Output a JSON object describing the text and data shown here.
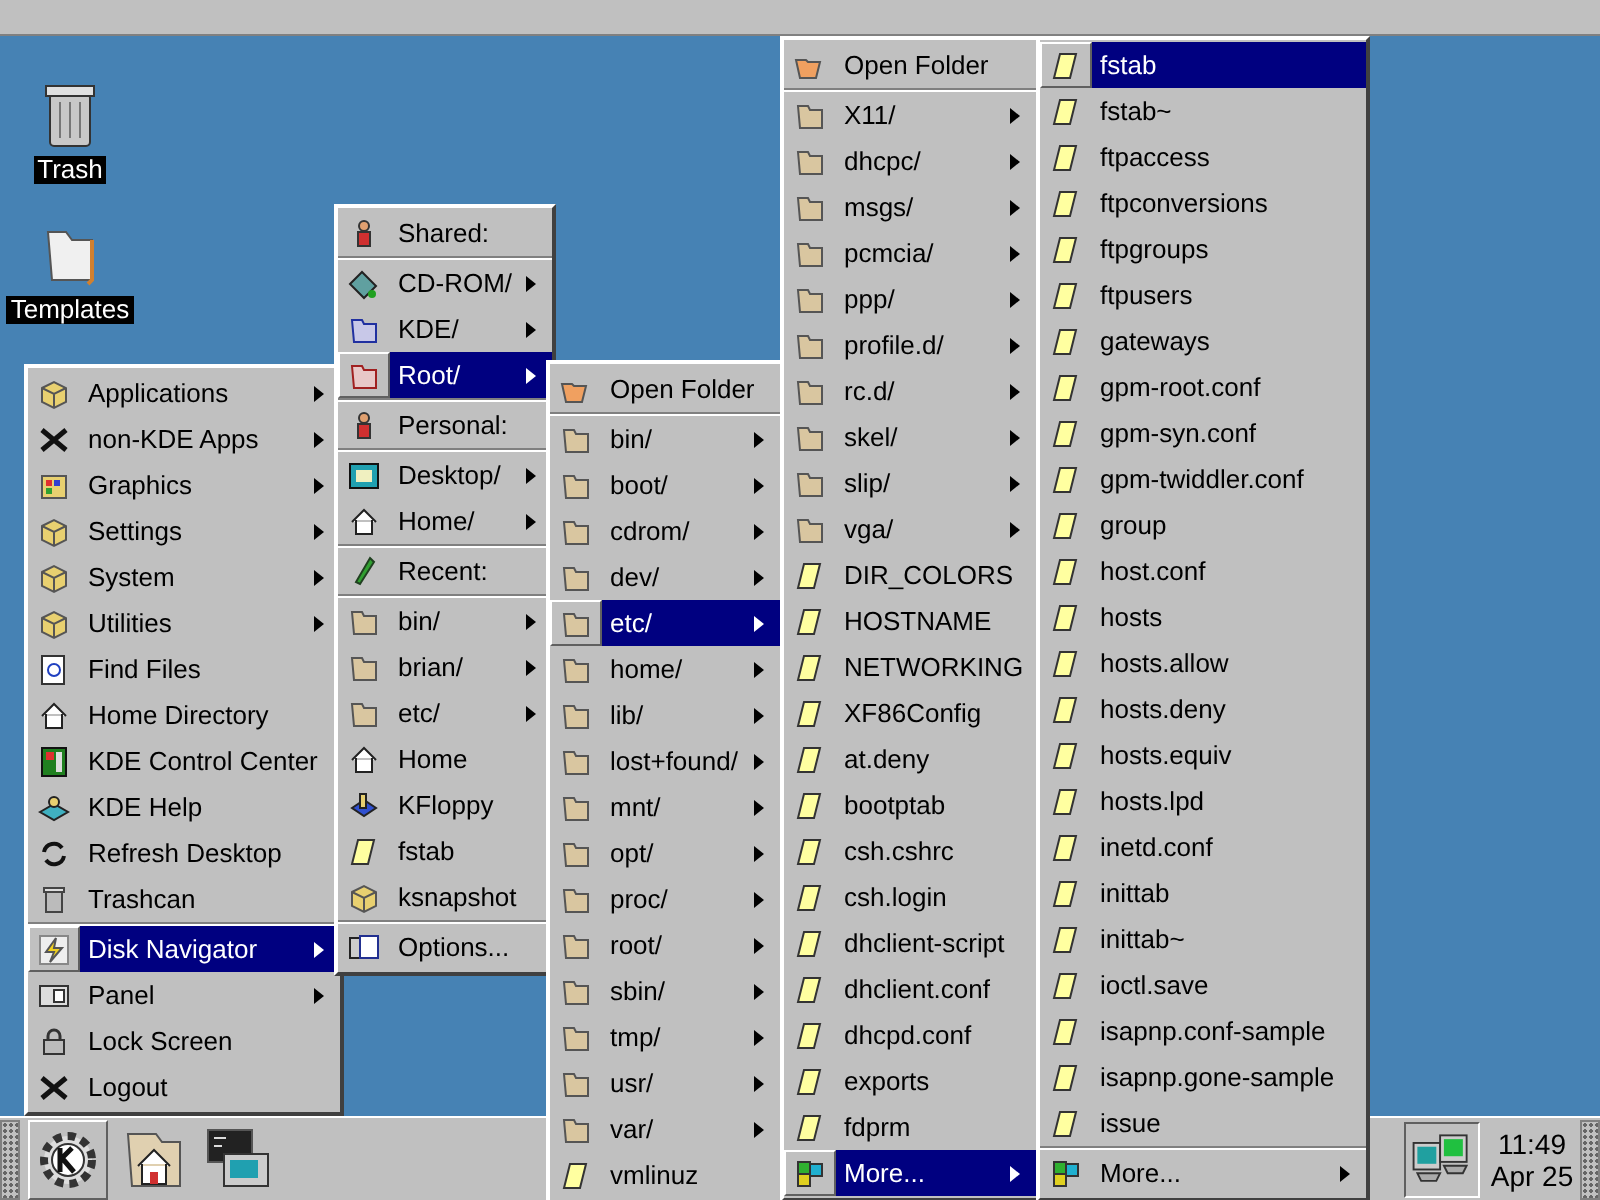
{
  "desktop_icons": [
    {
      "label": "Trash"
    },
    {
      "label": "Templates"
    }
  ],
  "menus": [
    {
      "items": [
        {
          "label": "Applications",
          "kind": "submenu",
          "selected": false
        },
        {
          "label": "non-KDE Apps",
          "kind": "submenu",
          "selected": false
        },
        {
          "label": "Graphics",
          "kind": "submenu",
          "selected": false
        },
        {
          "label": "Settings",
          "kind": "submenu",
          "selected": false
        },
        {
          "label": "System",
          "kind": "submenu",
          "selected": false
        },
        {
          "label": "Utilities",
          "kind": "submenu",
          "selected": false
        },
        {
          "label": "Find Files",
          "kind": "action",
          "selected": false
        },
        {
          "label": "Home Directory",
          "kind": "action",
          "selected": false
        },
        {
          "label": "KDE Control Center",
          "kind": "action",
          "selected": false
        },
        {
          "label": "KDE Help",
          "kind": "action",
          "selected": false
        },
        {
          "label": "Refresh Desktop",
          "kind": "action",
          "selected": false
        },
        {
          "label": "Trashcan",
          "kind": "action",
          "selected": false
        },
        {
          "kind": "separator"
        },
        {
          "label": "Disk Navigator",
          "kind": "submenu",
          "selected": true
        },
        {
          "label": "Panel",
          "kind": "submenu",
          "selected": false
        },
        {
          "label": "Lock Screen",
          "kind": "action",
          "selected": false
        },
        {
          "label": "Logout",
          "kind": "action",
          "selected": false
        }
      ]
    },
    {
      "items": [
        {
          "label": "Shared:",
          "kind": "header"
        },
        {
          "kind": "separator"
        },
        {
          "label": "CD-ROM/",
          "kind": "submenu",
          "selected": false
        },
        {
          "label": "KDE/",
          "kind": "submenu",
          "selected": false
        },
        {
          "label": "Root/",
          "kind": "submenu",
          "selected": true
        },
        {
          "kind": "separator"
        },
        {
          "label": "Personal:",
          "kind": "header"
        },
        {
          "kind": "separator"
        },
        {
          "label": "Desktop/",
          "kind": "submenu",
          "selected": false
        },
        {
          "label": "Home/",
          "kind": "submenu",
          "selected": false
        },
        {
          "kind": "separator"
        },
        {
          "label": "Recent:",
          "kind": "header"
        },
        {
          "kind": "separator"
        },
        {
          "label": "bin/",
          "kind": "submenu",
          "selected": false
        },
        {
          "label": "brian/",
          "kind": "submenu",
          "selected": false
        },
        {
          "label": "etc/",
          "kind": "submenu",
          "selected": false
        },
        {
          "label": "Home",
          "kind": "action",
          "selected": false
        },
        {
          "label": "KFloppy",
          "kind": "action",
          "selected": false
        },
        {
          "label": "fstab",
          "kind": "file",
          "selected": false
        },
        {
          "label": "ksnapshot",
          "kind": "action",
          "selected": false
        },
        {
          "kind": "separator"
        },
        {
          "label": "Options...",
          "kind": "action",
          "selected": false
        }
      ]
    },
    {
      "items": [
        {
          "label": "Open Folder",
          "kind": "open",
          "selected": false
        },
        {
          "kind": "separator"
        },
        {
          "label": "bin/",
          "kind": "submenu",
          "selected": false
        },
        {
          "label": "boot/",
          "kind": "submenu",
          "selected": false
        },
        {
          "label": "cdrom/",
          "kind": "submenu",
          "selected": false
        },
        {
          "label": "dev/",
          "kind": "submenu",
          "selected": false
        },
        {
          "label": "etc/",
          "kind": "submenu",
          "selected": true
        },
        {
          "label": "home/",
          "kind": "submenu",
          "selected": false
        },
        {
          "label": "lib/",
          "kind": "submenu",
          "selected": false
        },
        {
          "label": "lost+found/",
          "kind": "submenu",
          "selected": false
        },
        {
          "label": "mnt/",
          "kind": "submenu",
          "selected": false
        },
        {
          "label": "opt/",
          "kind": "submenu",
          "selected": false
        },
        {
          "label": "proc/",
          "kind": "submenu",
          "selected": false
        },
        {
          "label": "root/",
          "kind": "submenu",
          "selected": false
        },
        {
          "label": "sbin/",
          "kind": "submenu",
          "selected": false
        },
        {
          "label": "tmp/",
          "kind": "submenu",
          "selected": false
        },
        {
          "label": "usr/",
          "kind": "submenu",
          "selected": false
        },
        {
          "label": "var/",
          "kind": "submenu",
          "selected": false
        },
        {
          "label": "vmlinuz",
          "kind": "file",
          "selected": false
        }
      ]
    },
    {
      "items": [
        {
          "label": "Open Folder",
          "kind": "open",
          "selected": false
        },
        {
          "kind": "separator"
        },
        {
          "label": "X11/",
          "kind": "submenu",
          "selected": false
        },
        {
          "label": "dhcpc/",
          "kind": "submenu",
          "selected": false
        },
        {
          "label": "msgs/",
          "kind": "submenu",
          "selected": false
        },
        {
          "label": "pcmcia/",
          "kind": "submenu",
          "selected": false
        },
        {
          "label": "ppp/",
          "kind": "submenu",
          "selected": false
        },
        {
          "label": "profile.d/",
          "kind": "submenu",
          "selected": false
        },
        {
          "label": "rc.d/",
          "kind": "submenu",
          "selected": false
        },
        {
          "label": "skel/",
          "kind": "submenu",
          "selected": false
        },
        {
          "label": "slip/",
          "kind": "submenu",
          "selected": false
        },
        {
          "label": "vga/",
          "kind": "submenu",
          "selected": false
        },
        {
          "label": "DIR_COLORS",
          "kind": "file",
          "selected": false
        },
        {
          "label": "HOSTNAME",
          "kind": "file",
          "selected": false
        },
        {
          "label": "NETWORKING",
          "kind": "file",
          "selected": false
        },
        {
          "label": "XF86Config",
          "kind": "file",
          "selected": false
        },
        {
          "label": "at.deny",
          "kind": "file",
          "selected": false
        },
        {
          "label": "bootptab",
          "kind": "file",
          "selected": false
        },
        {
          "label": "csh.cshrc",
          "kind": "file",
          "selected": false
        },
        {
          "label": "csh.login",
          "kind": "file",
          "selected": false
        },
        {
          "label": "dhclient-script",
          "kind": "file",
          "selected": false
        },
        {
          "label": "dhclient.conf",
          "kind": "file",
          "selected": false
        },
        {
          "label": "dhcpd.conf",
          "kind": "file",
          "selected": false
        },
        {
          "label": "exports",
          "kind": "file",
          "selected": false
        },
        {
          "label": "fdprm",
          "kind": "file",
          "selected": false
        },
        {
          "label": "More...",
          "kind": "more",
          "selected": true
        }
      ]
    },
    {
      "items": [
        {
          "label": "fstab",
          "kind": "file",
          "selected": true
        },
        {
          "label": "fstab~",
          "kind": "file",
          "selected": false
        },
        {
          "label": "ftpaccess",
          "kind": "file",
          "selected": false
        },
        {
          "label": "ftpconversions",
          "kind": "file",
          "selected": false
        },
        {
          "label": "ftpgroups",
          "kind": "file",
          "selected": false
        },
        {
          "label": "ftpusers",
          "kind": "file",
          "selected": false
        },
        {
          "label": "gateways",
          "kind": "file",
          "selected": false
        },
        {
          "label": "gpm-root.conf",
          "kind": "file",
          "selected": false
        },
        {
          "label": "gpm-syn.conf",
          "kind": "file",
          "selected": false
        },
        {
          "label": "gpm-twiddler.conf",
          "kind": "file",
          "selected": false
        },
        {
          "label": "group",
          "kind": "file",
          "selected": false
        },
        {
          "label": "host.conf",
          "kind": "file",
          "selected": false
        },
        {
          "label": "hosts",
          "kind": "file",
          "selected": false
        },
        {
          "label": "hosts.allow",
          "kind": "file",
          "selected": false
        },
        {
          "label": "hosts.deny",
          "kind": "file",
          "selected": false
        },
        {
          "label": "hosts.equiv",
          "kind": "file",
          "selected": false
        },
        {
          "label": "hosts.lpd",
          "kind": "file",
          "selected": false
        },
        {
          "label": "inetd.conf",
          "kind": "file",
          "selected": false
        },
        {
          "label": "inittab",
          "kind": "file",
          "selected": false
        },
        {
          "label": "inittab~",
          "kind": "file",
          "selected": false
        },
        {
          "label": "ioctl.save",
          "kind": "file",
          "selected": false
        },
        {
          "label": "isapnp.conf-sample",
          "kind": "file",
          "selected": false
        },
        {
          "label": "isapnp.gone-sample",
          "kind": "file",
          "selected": false
        },
        {
          "label": "issue",
          "kind": "file",
          "selected": false
        },
        {
          "kind": "separator"
        },
        {
          "label": "More...",
          "kind": "more",
          "selected": false
        }
      ]
    }
  ],
  "clock": {
    "time": "11:49",
    "date": "Apr 25"
  }
}
